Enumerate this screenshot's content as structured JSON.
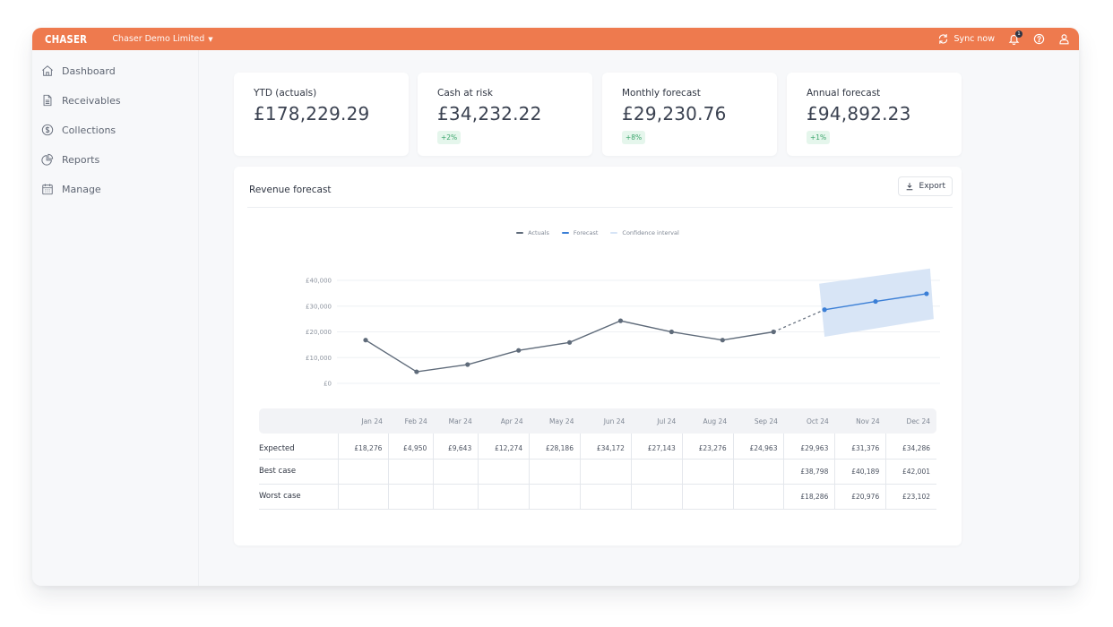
{
  "topbar": {
    "brand": "CHASER",
    "organization": "Chaser Demo Limited",
    "sync_label": "Sync now",
    "notification_count": "1",
    "accent_color": "#ee7a4e"
  },
  "sidebar": {
    "items": [
      {
        "label": "Dashboard",
        "icon": "home-icon"
      },
      {
        "label": "Receivables",
        "icon": "document-icon"
      },
      {
        "label": "Collections",
        "icon": "dollar-circle-icon"
      },
      {
        "label": "Reports",
        "icon": "pie-chart-icon"
      },
      {
        "label": "Manage",
        "icon": "calendar-icon"
      }
    ]
  },
  "kpis": [
    {
      "label": "YTD (actuals)",
      "value": "£178,229.29",
      "delta": null
    },
    {
      "label": "Cash at risk",
      "value": "£34,232.22",
      "delta": "+2%"
    },
    {
      "label": "Monthly forecast",
      "value": "£29,230.76",
      "delta": "+8%"
    },
    {
      "label": "Annual forecast",
      "value": "£94,892.23",
      "delta": "+1%"
    }
  ],
  "panel": {
    "title": "Revenue forecast",
    "export_label": "Export"
  },
  "chart_data": {
    "type": "line",
    "title": "Revenue forecast",
    "xlabel": "",
    "ylabel": "",
    "x": [
      "Jan 24",
      "Feb 24",
      "Mar 24",
      "Apr 24",
      "May 24",
      "Jun 24",
      "Jul 24",
      "Aug 24",
      "Sep 24",
      "Oct 24",
      "Nov 24",
      "Dec 24"
    ],
    "ylim": [
      0,
      40000
    ],
    "y_ticks": [
      0,
      10000,
      20000,
      30000,
      40000
    ],
    "y_tick_labels": [
      "£0",
      "£10,000",
      "£20,000",
      "£30,000",
      "£40,000"
    ],
    "grid": true,
    "legend_position": "top-center",
    "legend": [
      {
        "name": "Actuals",
        "color": "#5f6b7a"
      },
      {
        "name": "Forecast",
        "color": "#3b7fd6"
      },
      {
        "name": "Confidence interval",
        "color": "#d6e4f6"
      }
    ],
    "series": [
      {
        "name": "Actuals",
        "x_start": 0,
        "values": [
          16800,
          4500,
          7300,
          12800,
          15900,
          24300,
          20000,
          16800,
          20000
        ]
      },
      {
        "name": "Forecast",
        "x_start": 9,
        "values": [
          28600,
          31800,
          34800
        ]
      }
    ],
    "confidence_interval": {
      "x_start": 9,
      "upper": [
        38700,
        44600
      ],
      "lower": [
        18100,
        25000
      ]
    }
  },
  "table": {
    "columns": [
      "Jan 24",
      "Feb 24",
      "Mar 24",
      "Apr 24",
      "May 24",
      "Jun 24",
      "Jul 24",
      "Aug 24",
      "Sep 24",
      "Oct 24",
      "Nov 24",
      "Dec 24"
    ],
    "rows": [
      {
        "label": "Expected",
        "values": [
          "£18,276",
          "£4,950",
          "£9,643",
          "£12,274",
          "£28,186",
          "£34,172",
          "£27,143",
          "£23,276",
          "£24,963",
          "£29,963",
          "£31,376",
          "£34,286"
        ]
      },
      {
        "label": "Best case",
        "values": [
          "",
          "",
          "",
          "",
          "",
          "",
          "",
          "",
          "",
          "£38,798",
          "£40,189",
          "£42,001"
        ]
      },
      {
        "label": "Worst case",
        "values": [
          "",
          "",
          "",
          "",
          "",
          "",
          "",
          "",
          "",
          "£18,286",
          "£20,976",
          "£23,102"
        ]
      }
    ]
  }
}
